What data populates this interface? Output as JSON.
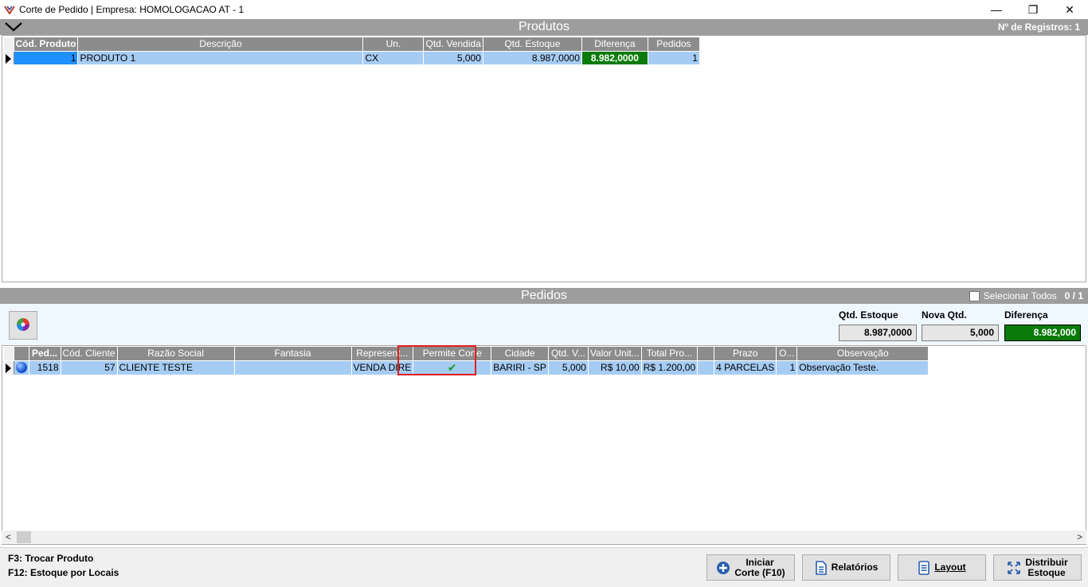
{
  "window": {
    "title": "Corte de Pedido | Empresa: HOMOLOGACAO AT - 1",
    "minimize": "—",
    "maximize": "❐",
    "close": "✕"
  },
  "produtos": {
    "title": "Produtos",
    "registros": "Nº de Registros: 1",
    "columns": [
      "Cód. Produto",
      "Descrição",
      "Un.",
      "Qtd. Vendida",
      "Qtd. Estoque",
      "Diferença",
      "Pedidos"
    ],
    "rows": [
      {
        "cod": "1",
        "descricao": "PRODUTO 1",
        "un": "CX",
        "qtd_vendida": "5,000",
        "qtd_estoque": "8.987,0000",
        "diferenca": "8.982,0000",
        "pedidos": "1"
      }
    ]
  },
  "pedidos": {
    "title": "Pedidos",
    "selecionar_todos": "Selecionar Todos",
    "count": "0 / 1",
    "stats": {
      "qtd_estoque_label": "Qtd. Estoque",
      "qtd_estoque": "8.987,0000",
      "nova_qtd_label": "Nova Qtd.",
      "nova_qtd": "5,000",
      "diferenca_label": "Diferença",
      "diferenca": "8.982,000"
    },
    "columns": [
      "Ped...",
      "Cód. Cliente",
      "Razão Social",
      "Fantasia",
      "Represent...",
      "Permite Corte",
      "Cidade",
      "Qtd. V...",
      "Valor Unit...",
      "Total Pro...",
      "",
      "Prazo",
      "O...",
      "Observação"
    ],
    "rows": [
      {
        "ped": "1518",
        "cod_cliente": "57",
        "razao_social": "CLIENTE TESTE",
        "fantasia": "",
        "represent": "VENDA DIRE",
        "permite_corte": "✔",
        "cidade": "BARIRI - SP",
        "qtd_v": "5,000",
        "valor_unit": "R$ 10,00",
        "total_pro": "R$ 1.200,00",
        "blank": "",
        "prazo": "4 PARCELAS",
        "o": "1",
        "observacao": "Observação Teste."
      }
    ]
  },
  "footer": {
    "key1": "F3: Trocar Produto",
    "key2": "F12:  Estoque por Locais",
    "btn_iniciar_1": "Iniciar",
    "btn_iniciar_2": "Corte (F10)",
    "btn_relatorios": "Relatórios",
    "btn_layout": "Layout",
    "btn_distribuir_1": "Distribuir",
    "btn_distribuir_2": "Estoque"
  },
  "colors": {
    "header_gray": "#9d9d9d",
    "row_selected": "#a6ccf3",
    "diff_green": "#0a7a0a",
    "highlight_red": "#e02020"
  }
}
